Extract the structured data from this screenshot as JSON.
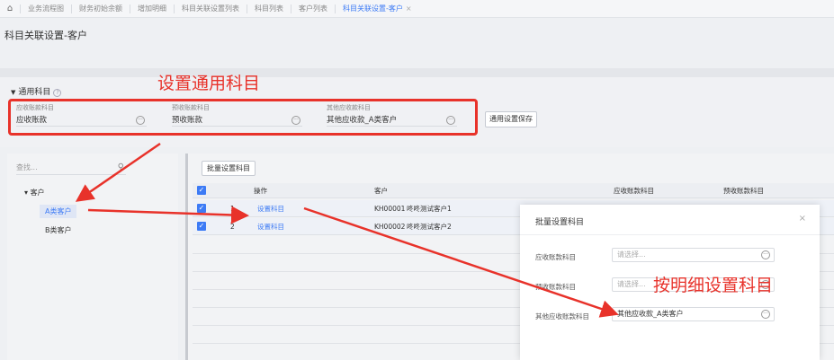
{
  "tabbar": {
    "home_icon": "home-icon",
    "tabs": [
      {
        "label": "业务流程图"
      },
      {
        "label": "财务初始余额"
      },
      {
        "label": "增加明细"
      },
      {
        "label": "科目关联设置列表"
      },
      {
        "label": "科目列表"
      },
      {
        "label": "客户列表"
      },
      {
        "label": "科目关联设置-客户",
        "active": true,
        "close": "×"
      }
    ]
  },
  "page": {
    "title": "科目关联设置-客户"
  },
  "common": {
    "caret": "▼",
    "title": "通用科目",
    "help": "?",
    "fields": [
      {
        "label": "应收账款科目",
        "value": "应收账款"
      },
      {
        "label": "预收账款科目",
        "value": "预收账款"
      },
      {
        "label": "其他应收款科目",
        "value": "其他应收款_A类客户"
      }
    ],
    "more_glyph": "···",
    "save_label": "通用设置保存"
  },
  "tree": {
    "search_placeholder": "查找...",
    "search_glyph": "⚲",
    "root_caret": "▾",
    "root": "客户",
    "children": [
      {
        "label": "A类客户",
        "selected": true
      },
      {
        "label": "B类客户"
      }
    ]
  },
  "grid": {
    "batch_label": "批量设置科目",
    "check_glyph": "✓",
    "columns": {
      "op": "操作",
      "customer": "客户",
      "ar": "应收账款科目",
      "pre": "预收账款科目"
    },
    "rows": [
      {
        "no": "1",
        "op": "设置科目",
        "code": "KH00001",
        "name": "咚咚测试客户1"
      },
      {
        "no": "2",
        "op": "设置科目",
        "code": "KH00002",
        "name": "咚咚测试客户2"
      }
    ]
  },
  "modal": {
    "title": "批量设置科目",
    "close": "×",
    "rows": [
      {
        "label": "应收账款科目",
        "value": "",
        "placeholder": "请选择..."
      },
      {
        "label": "预收账款科目",
        "value": "",
        "placeholder": "请选择..."
      },
      {
        "label": "其他应收账款科目",
        "value": "其他应收款_A类客户",
        "placeholder": ""
      }
    ]
  },
  "annotations": {
    "common": "设置通用科目",
    "detail": "按明细设置科目",
    "color": "#e8322a"
  }
}
